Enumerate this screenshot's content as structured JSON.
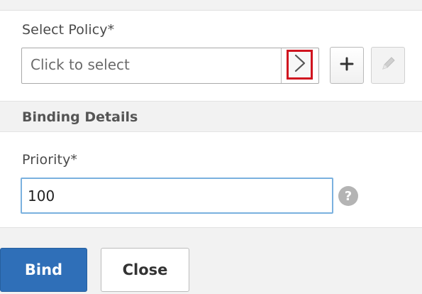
{
  "policy": {
    "label": "Select Policy*",
    "placeholder": "Click to select",
    "icons": {
      "arrow": "chevron-right-icon",
      "add": "plus-icon",
      "edit": "pencil-icon"
    }
  },
  "binding_details": {
    "title": "Binding Details",
    "priority": {
      "label": "Priority*",
      "value": "100",
      "help_icon": "question-mark-icon",
      "help_symbol": "?"
    }
  },
  "footer": {
    "bind_label": "Bind",
    "close_label": "Close"
  },
  "colors": {
    "accent": "#2f6fb8",
    "focus_border": "#7ab1df",
    "highlight": "#d0141f"
  }
}
